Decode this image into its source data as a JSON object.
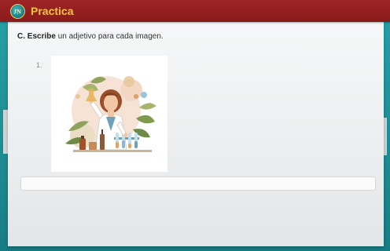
{
  "window": {
    "title": "Practica"
  },
  "exercise": {
    "instruction_bold": "C. Escribe",
    "instruction_rest": " un adjetivo para cada imagen.",
    "item_number": "1."
  },
  "answer": {
    "value": "",
    "placeholder": ""
  },
  "colors": {
    "title_bar": "#8a1b1b",
    "title_text": "#f4c542",
    "frame_teal": "#1f8f96",
    "card_bg": "#f1f2f3"
  },
  "icons": {
    "logo": "jn-logo-icon"
  }
}
